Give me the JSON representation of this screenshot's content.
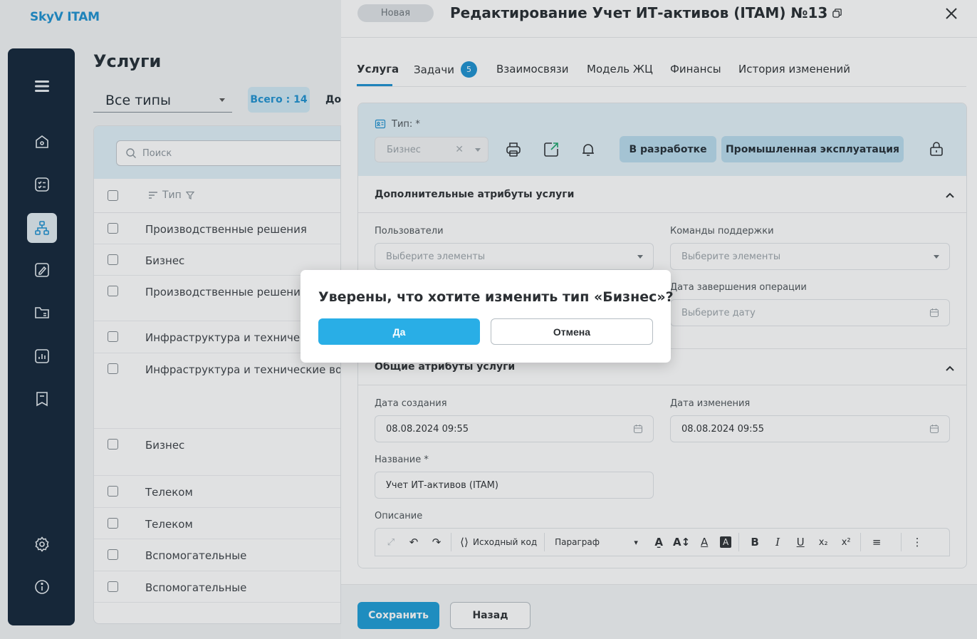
{
  "app": {
    "logo": "SkyV ITAM"
  },
  "sidebar": {
    "items": [
      {
        "icon": "menu-icon"
      },
      {
        "icon": "home-icon"
      },
      {
        "icon": "tasks-icon"
      },
      {
        "icon": "services-structure-icon",
        "active": true
      },
      {
        "icon": "edit-document-icon"
      },
      {
        "icon": "folder-icon"
      },
      {
        "icon": "reports-chart-icon"
      },
      {
        "icon": "bookmark-icon"
      },
      {
        "icon": "gear-icon"
      },
      {
        "icon": "info-icon"
      }
    ]
  },
  "list_page": {
    "title": "Услуги",
    "type_filter": "Все типы",
    "total_badge": "Всего : 14",
    "extra_tab": "До",
    "search_placeholder": "Поиск",
    "column_header": "Тип",
    "rows": [
      "Производственные решения",
      "Бизнес",
      "Производственные решения",
      "Инфраструктура и техническ",
      "Инфраструктура и технические вопр",
      "Бизнес",
      "Телеком",
      "Телеком",
      "Вспомогательные",
      "Вспомогательные"
    ]
  },
  "drawer": {
    "status": "Новая",
    "title": "Редактирование Учет ИТ-активов (ITAM) №13",
    "tabs": [
      {
        "label": "Услуга",
        "active": true
      },
      {
        "label": "Задачи",
        "badge": "5"
      },
      {
        "label": "Взаимосвязи"
      },
      {
        "label": "Модель ЖЦ"
      },
      {
        "label": "Финансы"
      },
      {
        "label": "История изменений"
      }
    ],
    "type_label": "Тип: *",
    "type_value": "Бизнес",
    "stage_buttons": [
      "В разработке",
      "Промышленная эксплуатация"
    ],
    "section_additional": "Дополнительные атрибуты услуги",
    "users_label": "Пользователи",
    "users_placeholder": "Выберите элементы",
    "teams_label": "Команды поддержки",
    "teams_placeholder": "Выберите элементы",
    "end_date_label": "Дата завершения операции",
    "end_date_placeholder": "Выберите дату",
    "section_general": "Общие атрибуты услуги",
    "created_label": "Дата создания",
    "created_value": "08.08.2024 09:55",
    "modified_label": "Дата изменения",
    "modified_value": "08.08.2024 09:55",
    "name_label": "Название *",
    "name_value": "Учет ИТ-активов (ITAM)",
    "description_label": "Описание",
    "editor": {
      "source_code": "Исходный код",
      "paragraph": "Параграф"
    },
    "save_label": "Сохранить",
    "back_label": "Назад"
  },
  "modal": {
    "question": "Уверены, что хотите изменить тип «Бизнес»?",
    "yes_label": "Да",
    "cancel_label": "Отмена"
  },
  "colors": {
    "accent": "#1a8fd0",
    "sidebar": "#0f2236",
    "primary_button": "#29aee6"
  }
}
